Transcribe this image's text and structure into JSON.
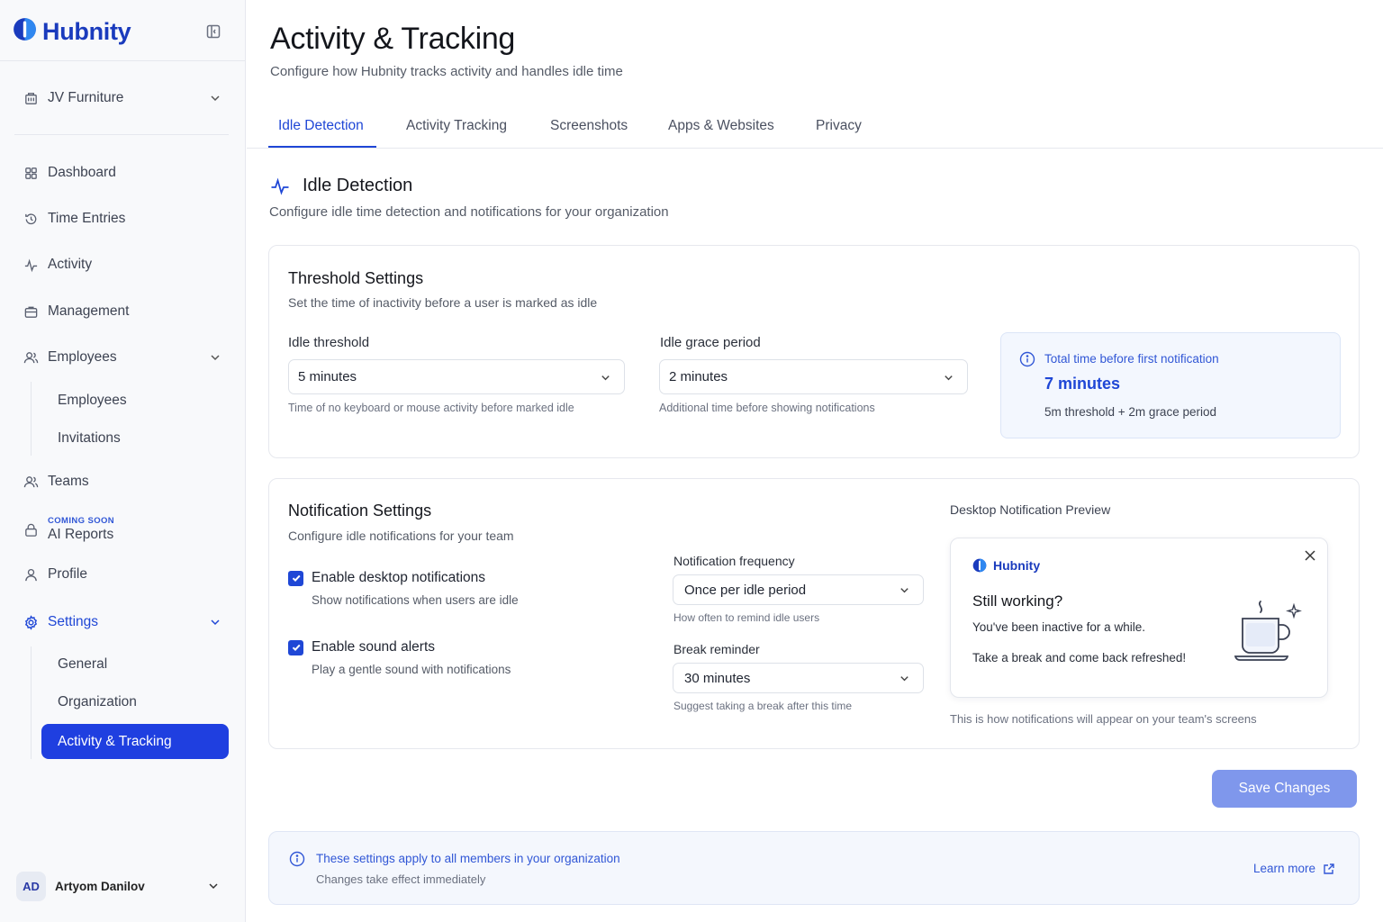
{
  "brand": {
    "name": "Hubnity"
  },
  "sidebar": {
    "workspace": "JV Furniture",
    "items": [
      {
        "label": "Dashboard",
        "icon": "grid-icon"
      },
      {
        "label": "Time Entries",
        "icon": "history-icon"
      },
      {
        "label": "Activity",
        "icon": "pulse-icon"
      },
      {
        "label": "Management",
        "icon": "briefcase-icon"
      },
      {
        "label": "Employees",
        "icon": "users-icon"
      },
      {
        "label": "Teams",
        "icon": "users-icon"
      },
      {
        "label": "AI Reports",
        "icon": "lock-icon",
        "badge": "COMING SOON"
      },
      {
        "label": "Profile",
        "icon": "user-icon"
      },
      {
        "label": "Settings",
        "icon": "gear-icon"
      }
    ],
    "employees_sub": [
      "Employees",
      "Invitations"
    ],
    "settings_sub": [
      "General",
      "Organization",
      "Activity & Tracking"
    ],
    "user": {
      "initials": "AD",
      "name": "Artyom Danilov"
    }
  },
  "header": {
    "title": "Activity & Tracking",
    "subtitle": "Configure how Hubnity tracks activity and handles idle time"
  },
  "tabs": [
    "Idle Detection",
    "Activity Tracking",
    "Screenshots",
    "Apps & Websites",
    "Privacy"
  ],
  "section": {
    "title": "Idle Detection",
    "subtitle": "Configure idle time detection and notifications for your organization"
  },
  "threshold": {
    "title": "Threshold Settings",
    "subtitle": "Set the time of inactivity before a user is marked as idle",
    "idle_label": "Idle threshold",
    "idle_value": "5 minutes",
    "idle_help": "Time of no keyboard or mouse activity before marked idle",
    "grace_label": "Idle grace period",
    "grace_value": "2 minutes",
    "grace_help": "Additional time before showing notifications",
    "info_title": "Total time before first notification",
    "info_value": "7 minutes",
    "info_note": "5m threshold + 2m grace period"
  },
  "notifications": {
    "title": "Notification Settings",
    "subtitle": "Configure idle notifications for your team",
    "desktop_label": "Enable desktop notifications",
    "desktop_sub": "Show notifications when users are idle",
    "sound_label": "Enable sound alerts",
    "sound_sub": "Play a gentle sound with notifications",
    "freq_label": "Notification frequency",
    "freq_value": "Once per idle period",
    "freq_help": "How often to remind idle users",
    "break_label": "Break reminder",
    "break_value": "30 minutes",
    "break_help": "Suggest taking a break after this time",
    "preview_label": "Desktop Notification Preview",
    "preview_brand": "Hubnity",
    "preview_title": "Still working?",
    "preview_line1": "You've been inactive for a while.",
    "preview_line2": "Take a break and come back refreshed!",
    "preview_foot": "This is how notifications will appear on your team's screens"
  },
  "actions": {
    "save": "Save Changes"
  },
  "notice": {
    "title": "These settings apply to all members in your organization",
    "subtitle": "Changes take effect immediately",
    "link": "Learn more"
  },
  "colors": {
    "accent": "#1f47d6",
    "active_nav": "#1f3fe0",
    "save_disabled": "#7f97ec"
  }
}
